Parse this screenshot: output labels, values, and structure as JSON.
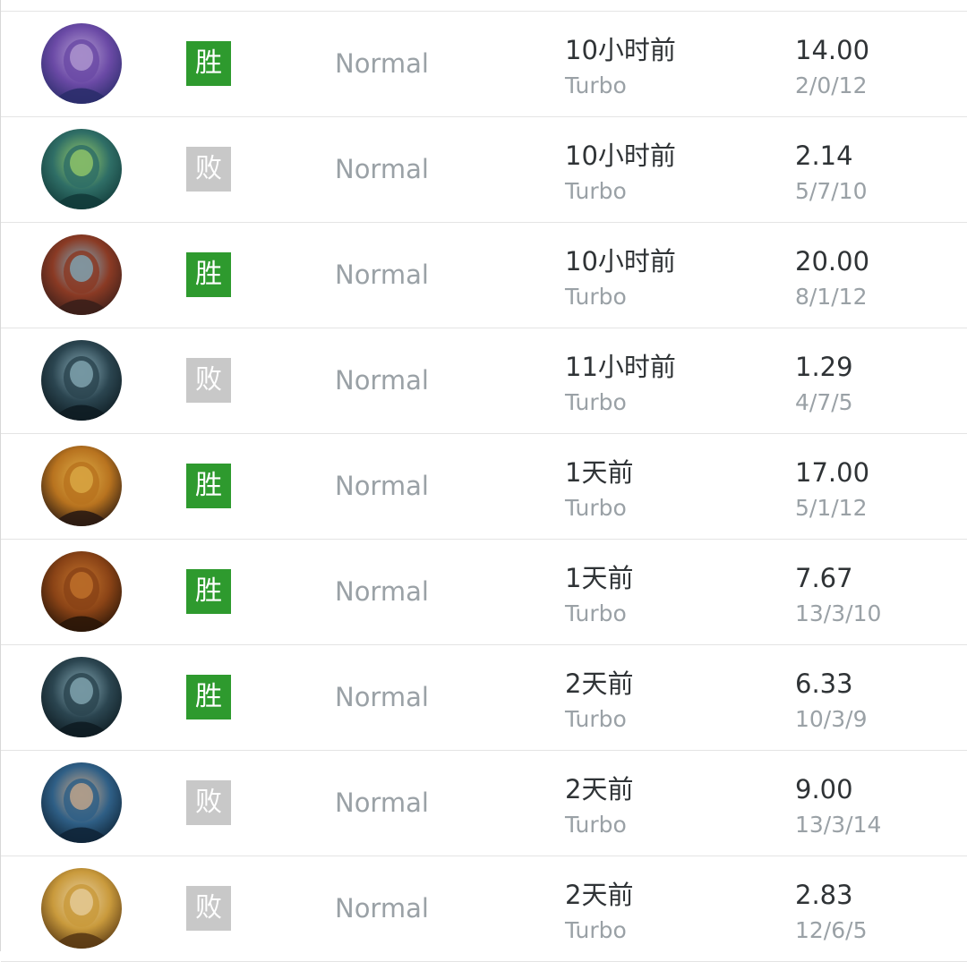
{
  "matches": [
    {
      "hero": "ratlike-purple-hero",
      "result": "胜",
      "result_color": "#2e9a2e",
      "mode": "Normal",
      "time_ago": "10小时前",
      "game_type": "Turbo",
      "kda_ratio": "14.00",
      "kda": "2/0/12",
      "avatar_colors": [
        "#2b2d6b",
        "#6b4aa6",
        "#b9a3d6"
      ]
    },
    {
      "hero": "goggled-bearded-hero",
      "result": "败",
      "result_color": "#c8c8c8",
      "mode": "Normal",
      "time_ago": "10小时前",
      "game_type": "Turbo",
      "kda_ratio": "2.14",
      "kda": "5/7/10",
      "avatar_colors": [
        "#123b3a",
        "#2f6e66",
        "#9fd36a"
      ]
    },
    {
      "hero": "fanged-creature-hero",
      "result": "胜",
      "result_color": "#2e9a2e",
      "mode": "Normal",
      "time_ago": "10小时前",
      "game_type": "Turbo",
      "kda_ratio": "20.00",
      "kda": "8/1/12",
      "avatar_colors": [
        "#3b1f1a",
        "#8a3a24",
        "#7fb3c8"
      ]
    },
    {
      "hero": "helmeted-dark-assassin-hero",
      "result": "败",
      "result_color": "#c8c8c8",
      "mode": "Normal",
      "time_ago": "11小时前",
      "game_type": "Turbo",
      "kda_ratio": "1.29",
      "kda": "4/7/5",
      "avatar_colors": [
        "#0e1c22",
        "#2b4550",
        "#8fb3bf"
      ]
    },
    {
      "hero": "golden-armored-hero",
      "result": "胜",
      "result_color": "#2e9a2e",
      "mode": "Normal",
      "time_ago": "1天前",
      "game_type": "Turbo",
      "kda_ratio": "17.00",
      "kda": "5/1/12",
      "avatar_colors": [
        "#2a1a12",
        "#b8731f",
        "#e0b04a"
      ]
    },
    {
      "hero": "bearded-dwarf-hero",
      "result": "胜",
      "result_color": "#2e9a2e",
      "mode": "Normal",
      "time_ago": "1天前",
      "game_type": "Turbo",
      "kda_ratio": "7.67",
      "kda": "13/3/10",
      "avatar_colors": [
        "#2a1608",
        "#8a4316",
        "#c7772e"
      ]
    },
    {
      "hero": "helmeted-dark-assassin-hero",
      "result": "胜",
      "result_color": "#2e9a2e",
      "mode": "Normal",
      "time_ago": "2天前",
      "game_type": "Turbo",
      "kda_ratio": "6.33",
      "kda": "10/3/9",
      "avatar_colors": [
        "#0e1c22",
        "#2b4550",
        "#8fb3bf"
      ]
    },
    {
      "hero": "dark-haired-mage-hero",
      "result": "败",
      "result_color": "#c8c8c8",
      "mode": "Normal",
      "time_ago": "2天前",
      "game_type": "Turbo",
      "kda_ratio": "9.00",
      "kda": "13/3/14",
      "avatar_colors": [
        "#0f2538",
        "#2f5f86",
        "#d8b08c"
      ]
    },
    {
      "hero": "winged-helm-hero",
      "result": "败",
      "result_color": "#c8c8c8",
      "mode": "Normal",
      "time_ago": "2天前",
      "game_type": "Turbo",
      "kda_ratio": "2.83",
      "kda": "12/6/5",
      "avatar_colors": [
        "#5a3a14",
        "#c99a3c",
        "#e9d3a6"
      ]
    }
  ]
}
